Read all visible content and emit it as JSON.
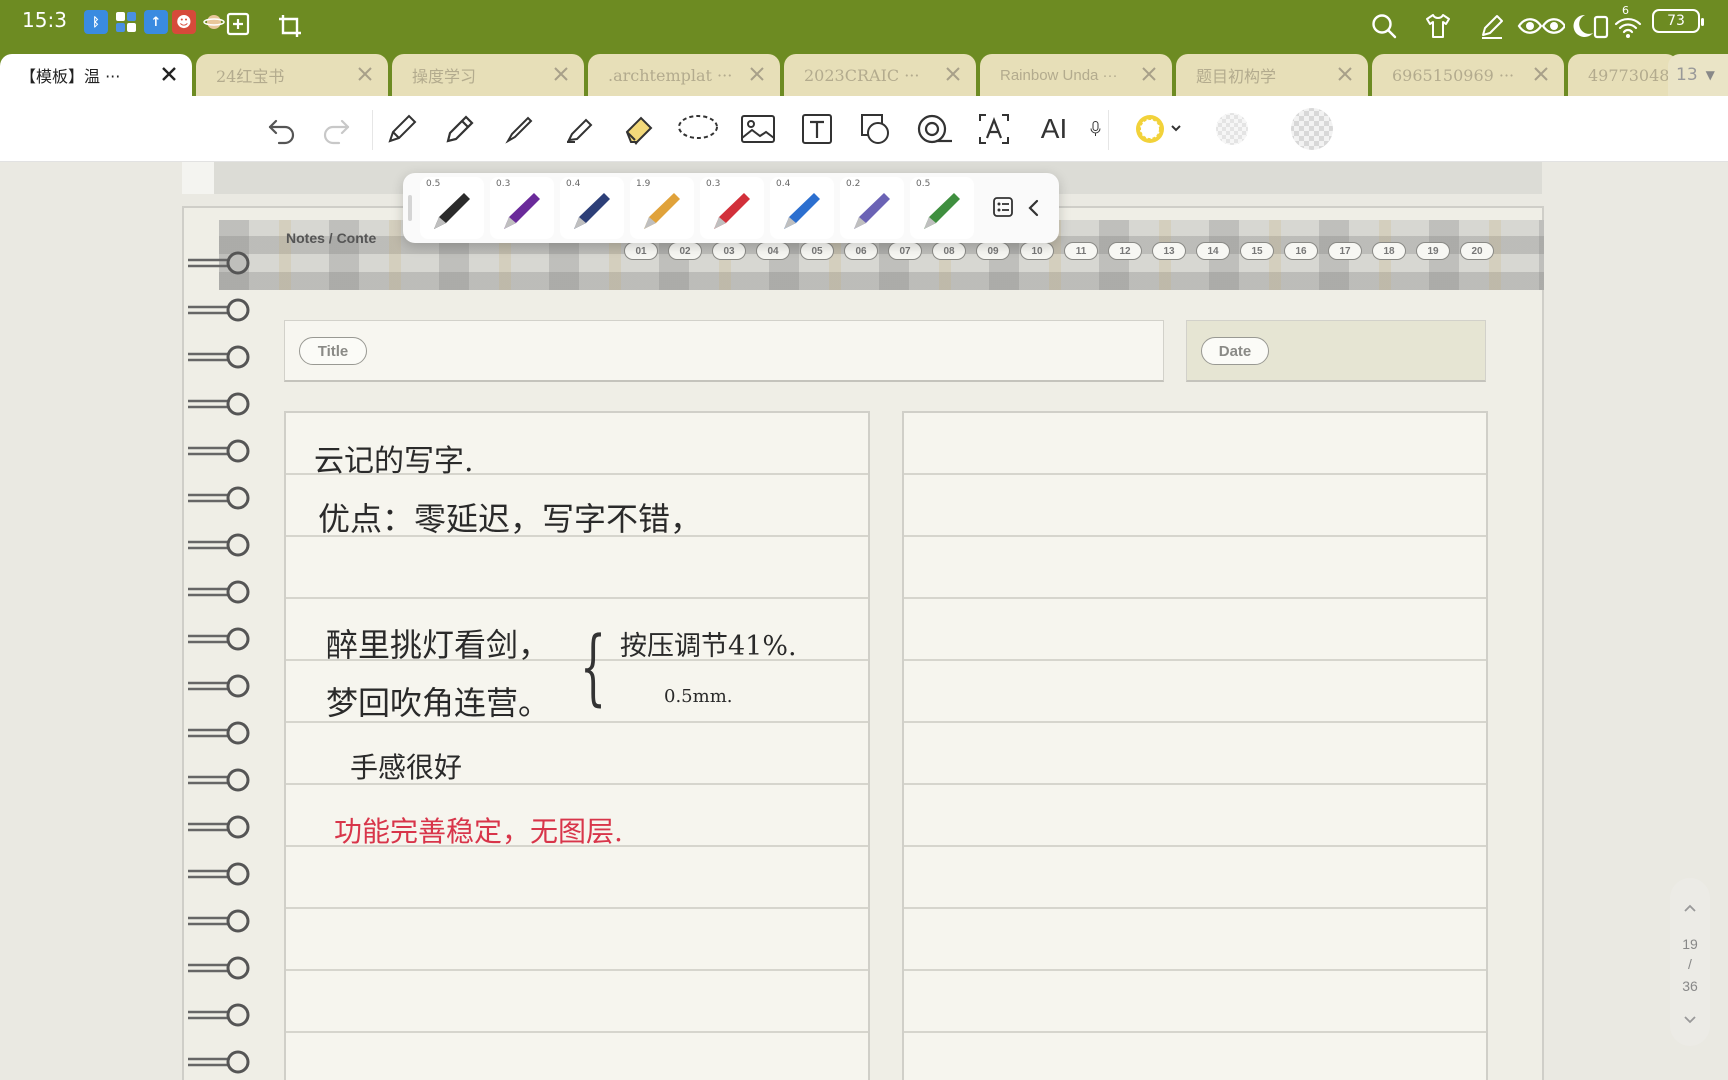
{
  "status_bar": {
    "time": "15:3",
    "wifi_badge": "6",
    "battery": "73"
  },
  "tabs": [
    {
      "label": "【模板】温 ···"
    },
    {
      "label": "24红宝书"
    },
    {
      "label": "操度学习"
    },
    {
      "label": ".archtemplat ···"
    },
    {
      "label": "2023CRAIC ···"
    },
    {
      "label": "Rainbow Unda ···"
    },
    {
      "label": "题目初构学"
    },
    {
      "label": "6965150969 ···"
    },
    {
      "label": "49773048"
    }
  ],
  "tab_count": "13",
  "toolbar": {
    "ai_label": "AI",
    "accent_color": "#f2d23a"
  },
  "pens": [
    {
      "size": "0.5",
      "color": "#2b2b2b"
    },
    {
      "size": "0.3",
      "color": "#6a2a9a"
    },
    {
      "size": "0.4",
      "color": "#2d3f78"
    },
    {
      "size": "1.9",
      "color": "#e0a23a"
    },
    {
      "size": "0.3",
      "color": "#d2303a"
    },
    {
      "size": "0.4",
      "color": "#2c6fcf"
    },
    {
      "size": "0.2",
      "color": "#6b63b5"
    },
    {
      "size": "0.5",
      "color": "#3f8f3f"
    }
  ],
  "template": {
    "breadcrumb": "Notes  /  Conte",
    "page_numbers": [
      "01",
      "02",
      "03",
      "04",
      "05",
      "06",
      "07",
      "08",
      "09",
      "10",
      "11",
      "12",
      "13",
      "14",
      "15",
      "16",
      "17",
      "18",
      "19",
      "20"
    ],
    "title_label": "Title",
    "date_label": "Date"
  },
  "handwriting": {
    "line1": "云记的写字.",
    "line2": "优点：零延迟，写字不错，",
    "line3": "醉里挑灯看剑，",
    "line4": "梦回吹角连营。",
    "note1": "按压调节41%.",
    "note2": "0.5mm.",
    "line5": "手感很好",
    "line6": "功能完善稳定，无图层."
  },
  "page_indicator": {
    "current": "19",
    "separator": "/",
    "total": "36"
  }
}
